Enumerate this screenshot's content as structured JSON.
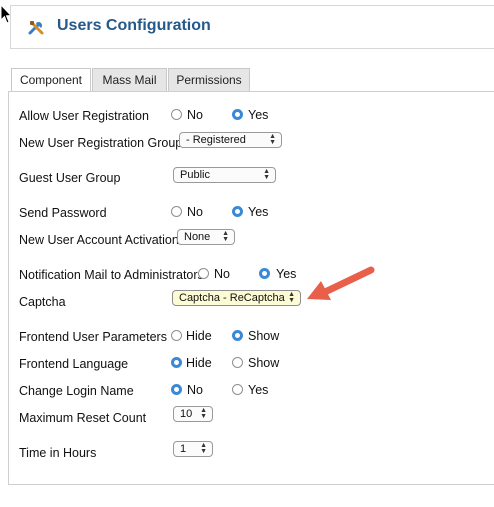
{
  "header": {
    "title": "Users Configuration"
  },
  "tabs": [
    {
      "label": "Component",
      "active": true
    },
    {
      "label": "Mass Mail",
      "active": false
    },
    {
      "label": "Permissions",
      "active": false
    }
  ],
  "fields": {
    "allow_user_registration": {
      "label": "Allow User Registration",
      "options": [
        "No",
        "Yes"
      ],
      "selected": "Yes"
    },
    "new_user_registration_group": {
      "label": "New User Registration Group",
      "value": "- Registered"
    },
    "guest_user_group": {
      "label": "Guest User Group",
      "value": "Public"
    },
    "send_password": {
      "label": "Send Password",
      "options": [
        "No",
        "Yes"
      ],
      "selected": "Yes"
    },
    "new_user_account_activation": {
      "label": "New User Account Activation",
      "value": "None"
    },
    "notification_mail": {
      "label": "Notification Mail to Administrators",
      "options": [
        "No",
        "Yes"
      ],
      "selected": "Yes"
    },
    "captcha": {
      "label": "Captcha",
      "value": "Captcha - ReCaptcha"
    },
    "frontend_user_parameters": {
      "label": "Frontend User Parameters",
      "options": [
        "Hide",
        "Show"
      ],
      "selected": "Show"
    },
    "frontend_language": {
      "label": "Frontend Language",
      "options": [
        "Hide",
        "Show"
      ],
      "selected": "Hide"
    },
    "change_login_name": {
      "label": "Change Login Name",
      "options": [
        "No",
        "Yes"
      ],
      "selected": "No"
    },
    "maximum_reset_count": {
      "label": "Maximum Reset Count",
      "value": "10"
    },
    "time_in_hours": {
      "label": "Time in Hours",
      "value": "1"
    }
  },
  "colors": {
    "title": "#25598a",
    "radio_selected": "#3a89d8",
    "annotation_arrow": "#e8604a",
    "captcha_highlight": "#fdfbd4"
  },
  "icons": [
    "mouse-cursor-icon",
    "tools-icon",
    "annotation-arrow-icon"
  ]
}
